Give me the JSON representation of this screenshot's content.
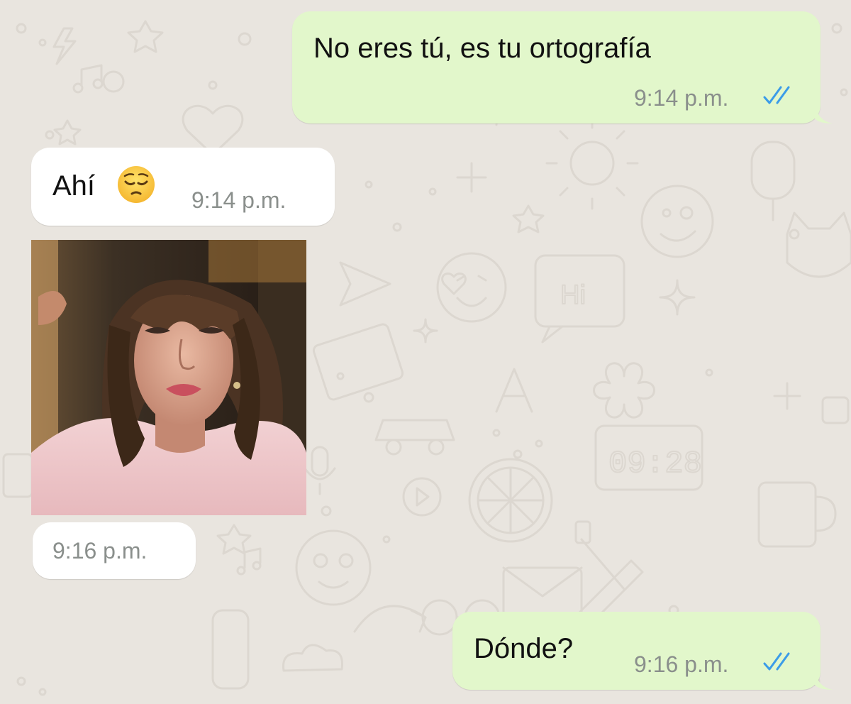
{
  "messages": [
    {
      "direction": "outgoing",
      "text": "No eres tú, es tu ortografía",
      "time": "9:14 p.m.",
      "status_icon": "double-check-read-icon"
    },
    {
      "direction": "incoming",
      "text": "Ahí",
      "emoji": "pensive-face-emoji",
      "time": "9:14 p.m."
    },
    {
      "direction": "incoming",
      "type": "gif",
      "media": "woman-crying-gif",
      "time": "9:16 p.m."
    },
    {
      "direction": "outgoing",
      "text": "Dónde?",
      "time": "9:16 p.m.",
      "status_icon": "double-check-read-icon"
    }
  ],
  "colors": {
    "wallpaper": "#e9e5df",
    "outgoing_bubble": "#e2f7cb",
    "incoming_bubble": "#ffffff",
    "read_ticks": "#3b9ce8",
    "timestamp": "#8a8f8c"
  }
}
